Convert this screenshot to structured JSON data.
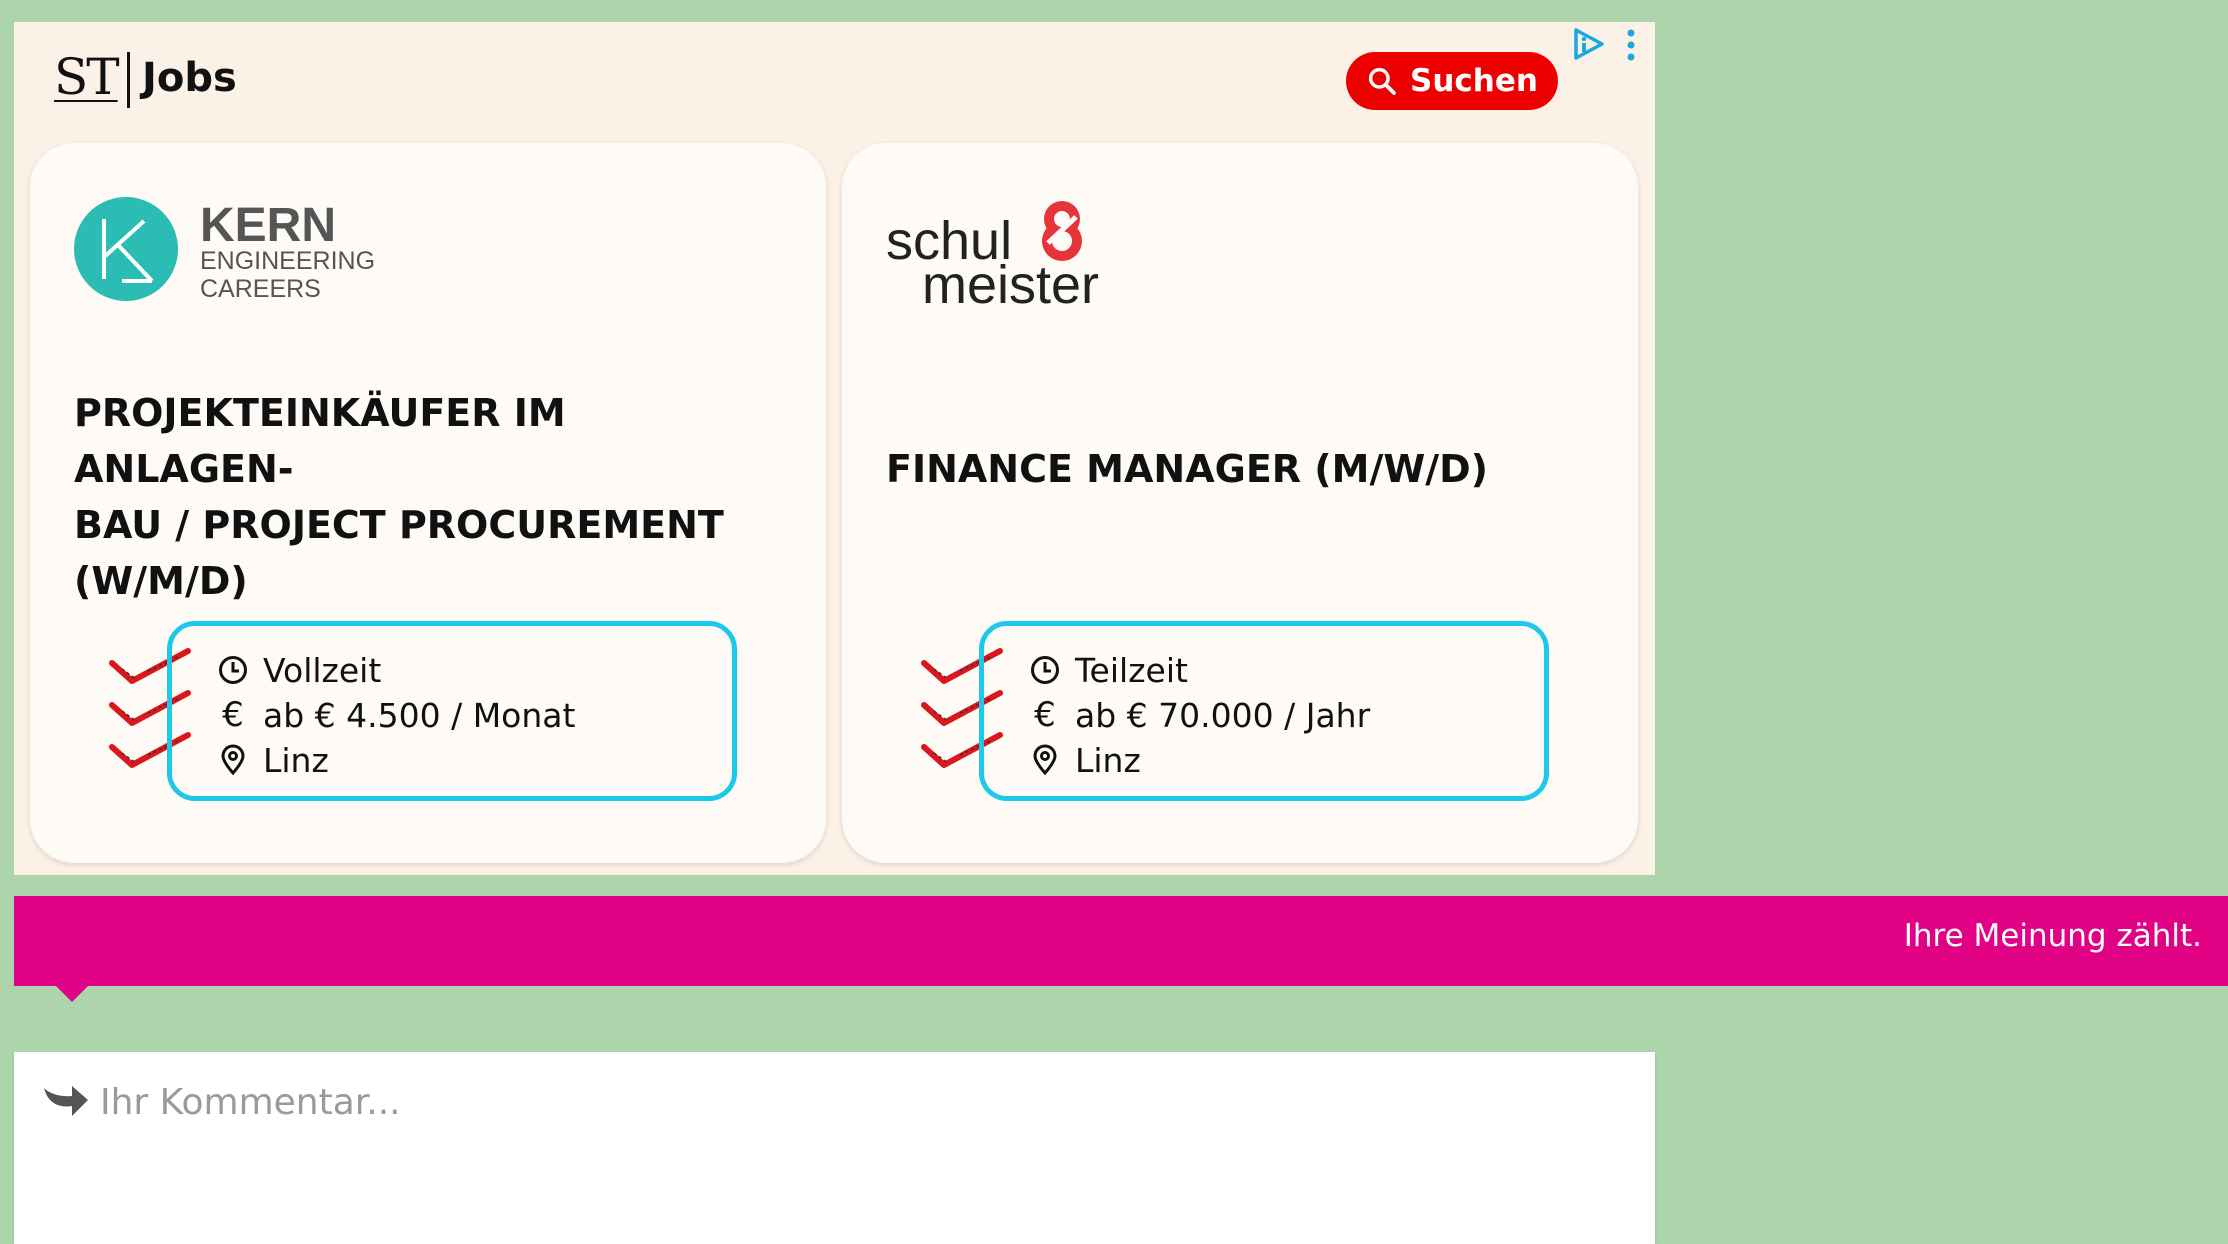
{
  "ad": {
    "brand": {
      "mark": "ST",
      "name": "Jobs"
    },
    "search_label": "Suchen",
    "adchoices_icon": "adchoices-icon",
    "menu_icon": "kebab-menu-icon",
    "background": "#fcf1e6",
    "accent_red": "#ee0000",
    "cards": [
      {
        "company_logo": {
          "name": "KERN",
          "line1": "ENGINEERING",
          "line2": "CAREERS",
          "color": "#2bbdb3"
        },
        "title": "PROJEKTEINKÄUFER IM ANLAGEN-BAU / PROJECT PROCUREMENT (W/M/D)",
        "title_lines": [
          "PROJEKTEINKÄUFER IM ANLAGEN-",
          "BAU / PROJECT PROCUREMENT",
          "(W/M/D)"
        ],
        "employment": "Vollzeit",
        "salary": "ab € 4.500 / Monat",
        "location": "Linz"
      },
      {
        "company_logo": {
          "line1": "schul",
          "line2": "meister",
          "mark_color": "#e5343a"
        },
        "title": "FINANCE MANAGER (M/W/D)",
        "title_lines": [
          "FINANCE MANAGER (M/W/D)"
        ],
        "employment": "Teilzeit",
        "salary": "ab € 70.000 / Jahr",
        "location": "Linz"
      }
    ],
    "detail_icons": {
      "employment": "clock-icon",
      "salary": "euro-icon",
      "location": "location-pin-icon"
    },
    "border_color": "#1ec8ea"
  },
  "opinion": {
    "text": "Ihre Meinung zählt.",
    "color": "#e10185"
  },
  "comment": {
    "placeholder": "Ihr Kommentar...",
    "value": ""
  }
}
